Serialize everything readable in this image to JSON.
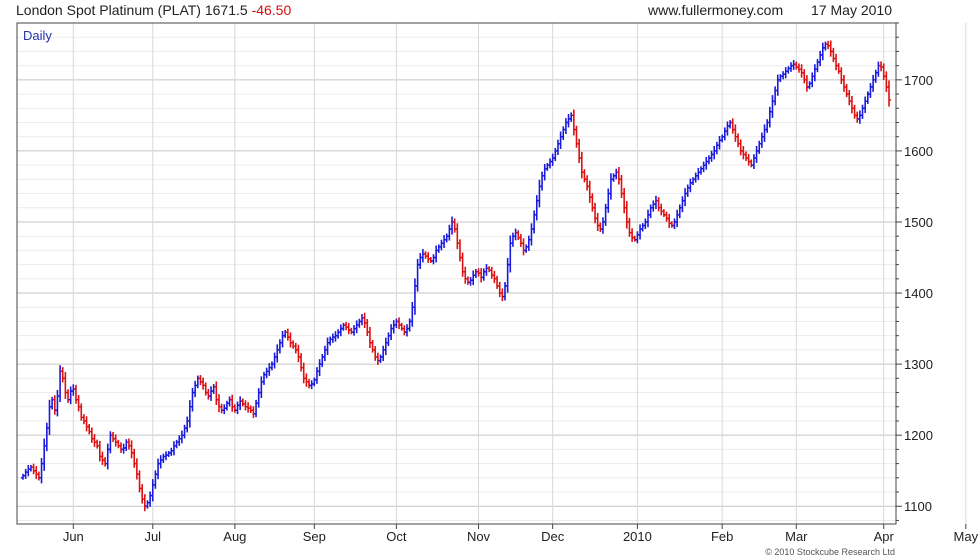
{
  "header": {
    "instrument": "London Spot Platinum (PLAT) 1671.5",
    "change": "-46.50",
    "site": "www.fullermoney.com",
    "date": "17 May 2010"
  },
  "period_label": "Daily",
  "copyright": "© 2010 Stockcube Research Ltd",
  "colors": {
    "up": "#1a1adc",
    "down": "#dc1010",
    "grid": "#c8c8c8",
    "frame": "#444444"
  },
  "chart_data": {
    "type": "ohlc",
    "title": "London Spot Platinum (PLAT) 1671.5 -46.50",
    "ylim": [
      1075,
      1780
    ],
    "y_ticks": [
      1100,
      1200,
      1300,
      1400,
      1500,
      1600,
      1700
    ],
    "x_tick_labels": [
      "Jun",
      "Jul",
      "Aug",
      "Sep",
      "Oct",
      "Nov",
      "Dec",
      "2010",
      "Feb",
      "Mar",
      "Apr",
      "May"
    ],
    "x_tick_bar_index": [
      19,
      49,
      80,
      110,
      141,
      172,
      200,
      232,
      264,
      292,
      325,
      356
    ],
    "grid": true,
    "closes": [
      1143,
      1148,
      1152,
      1155,
      1150,
      1145,
      1140,
      1160,
      1185,
      1210,
      1240,
      1250,
      1235,
      1255,
      1290,
      1280,
      1260,
      1250,
      1262,
      1265,
      1250,
      1240,
      1225,
      1220,
      1212,
      1205,
      1195,
      1190,
      1185,
      1170,
      1165,
      1160,
      1180,
      1200,
      1195,
      1190,
      1185,
      1180,
      1182,
      1190,
      1185,
      1175,
      1160,
      1145,
      1125,
      1110,
      1100,
      1105,
      1115,
      1130,
      1145,
      1160,
      1165,
      1170,
      1172,
      1175,
      1178,
      1185,
      1190,
      1195,
      1200,
      1210,
      1220,
      1240,
      1260,
      1270,
      1280,
      1275,
      1270,
      1260,
      1255,
      1262,
      1268,
      1250,
      1240,
      1235,
      1238,
      1245,
      1250,
      1240,
      1235,
      1242,
      1248,
      1244,
      1240,
      1238,
      1235,
      1230,
      1245,
      1260,
      1275,
      1285,
      1290,
      1295,
      1300,
      1310,
      1320,
      1330,
      1340,
      1345,
      1338,
      1330,
      1325,
      1320,
      1310,
      1295,
      1280,
      1275,
      1270,
      1272,
      1278,
      1290,
      1300,
      1310,
      1320,
      1330,
      1335,
      1338,
      1340,
      1345,
      1350,
      1355,
      1352,
      1348,
      1345,
      1350,
      1355,
      1360,
      1365,
      1358,
      1345,
      1330,
      1320,
      1310,
      1305,
      1310,
      1320,
      1330,
      1340,
      1350,
      1355,
      1360,
      1355,
      1350,
      1345,
      1350,
      1360,
      1380,
      1410,
      1440,
      1450,
      1455,
      1452,
      1448,
      1445,
      1450,
      1460,
      1465,
      1470,
      1475,
      1480,
      1490,
      1500,
      1490,
      1470,
      1450,
      1430,
      1420,
      1415,
      1418,
      1425,
      1430,
      1428,
      1422,
      1430,
      1435,
      1432,
      1425,
      1420,
      1410,
      1400,
      1395,
      1410,
      1440,
      1470,
      1480,
      1485,
      1478,
      1470,
      1460,
      1465,
      1475,
      1490,
      1510,
      1530,
      1550,
      1565,
      1575,
      1580,
      1585,
      1590,
      1600,
      1610,
      1620,
      1630,
      1640,
      1645,
      1650,
      1630,
      1610,
      1590,
      1570,
      1560,
      1550,
      1535,
      1520,
      1505,
      1495,
      1490,
      1500,
      1520,
      1540,
      1560,
      1565,
      1570,
      1560,
      1540,
      1520,
      1500,
      1485,
      1478,
      1475,
      1482,
      1490,
      1495,
      1500,
      1510,
      1520,
      1525,
      1530,
      1520,
      1515,
      1510,
      1505,
      1498,
      1495,
      1500,
      1510,
      1520,
      1530,
      1540,
      1548,
      1555,
      1560,
      1565,
      1570,
      1575,
      1580,
      1585,
      1590,
      1595,
      1600,
      1608,
      1615,
      1620,
      1628,
      1635,
      1640,
      1630,
      1620,
      1610,
      1600,
      1595,
      1590,
      1585,
      1580,
      1590,
      1600,
      1610,
      1620,
      1630,
      1640,
      1655,
      1670,
      1685,
      1700,
      1705,
      1708,
      1712,
      1716,
      1720,
      1722,
      1718,
      1715,
      1710,
      1700,
      1690,
      1695,
      1705,
      1715,
      1725,
      1735,
      1745,
      1750,
      1748,
      1740,
      1730,
      1720,
      1712,
      1700,
      1690,
      1680,
      1670,
      1660,
      1650,
      1645,
      1650,
      1660,
      1670,
      1680,
      1690,
      1700,
      1710,
      1720,
      1718,
      1705,
      1690,
      1671.5
    ]
  }
}
